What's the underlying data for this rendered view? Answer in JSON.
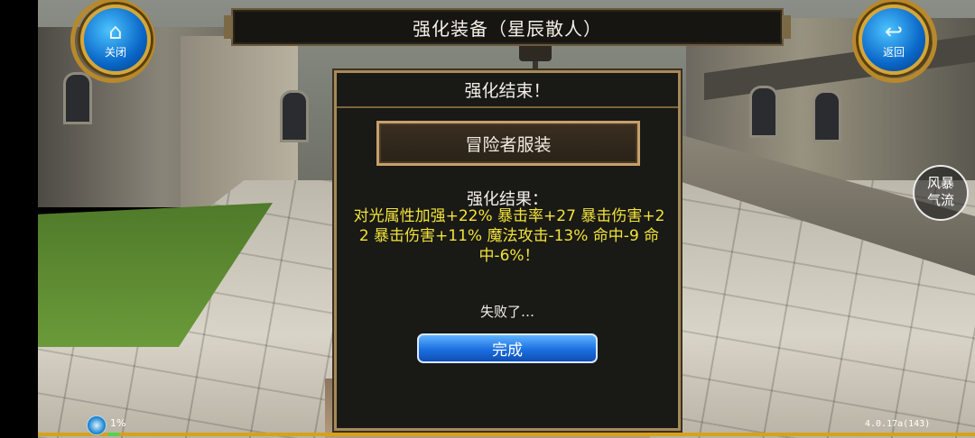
{
  "header": {
    "title": "强化装备（星辰散人）"
  },
  "buttons": {
    "close": {
      "label": "关闭",
      "icon": "home-icon"
    },
    "back": {
      "label": "返回",
      "icon": "back-arrow-icon"
    }
  },
  "dialog": {
    "title": "强化结束！",
    "item_name": "冒险者服装",
    "result_label": "强化结果：",
    "result_text": "对光属性加强+22% 暴击率+27 暴击伤害+22 暴击伤害+11% 魔法攻击-13% 命中-9 命中-6%！",
    "status": "失败了…",
    "confirm_label": "完成"
  },
  "skill_button": {
    "line1": "风暴",
    "line2": "气流"
  },
  "status_bar": {
    "exp_percent": "1%",
    "version": "4.0.17a(143)"
  },
  "colors": {
    "result_text": "#f2e33a",
    "confirm_button": "#1c6fe0",
    "frame_gold": "#a68a57"
  }
}
